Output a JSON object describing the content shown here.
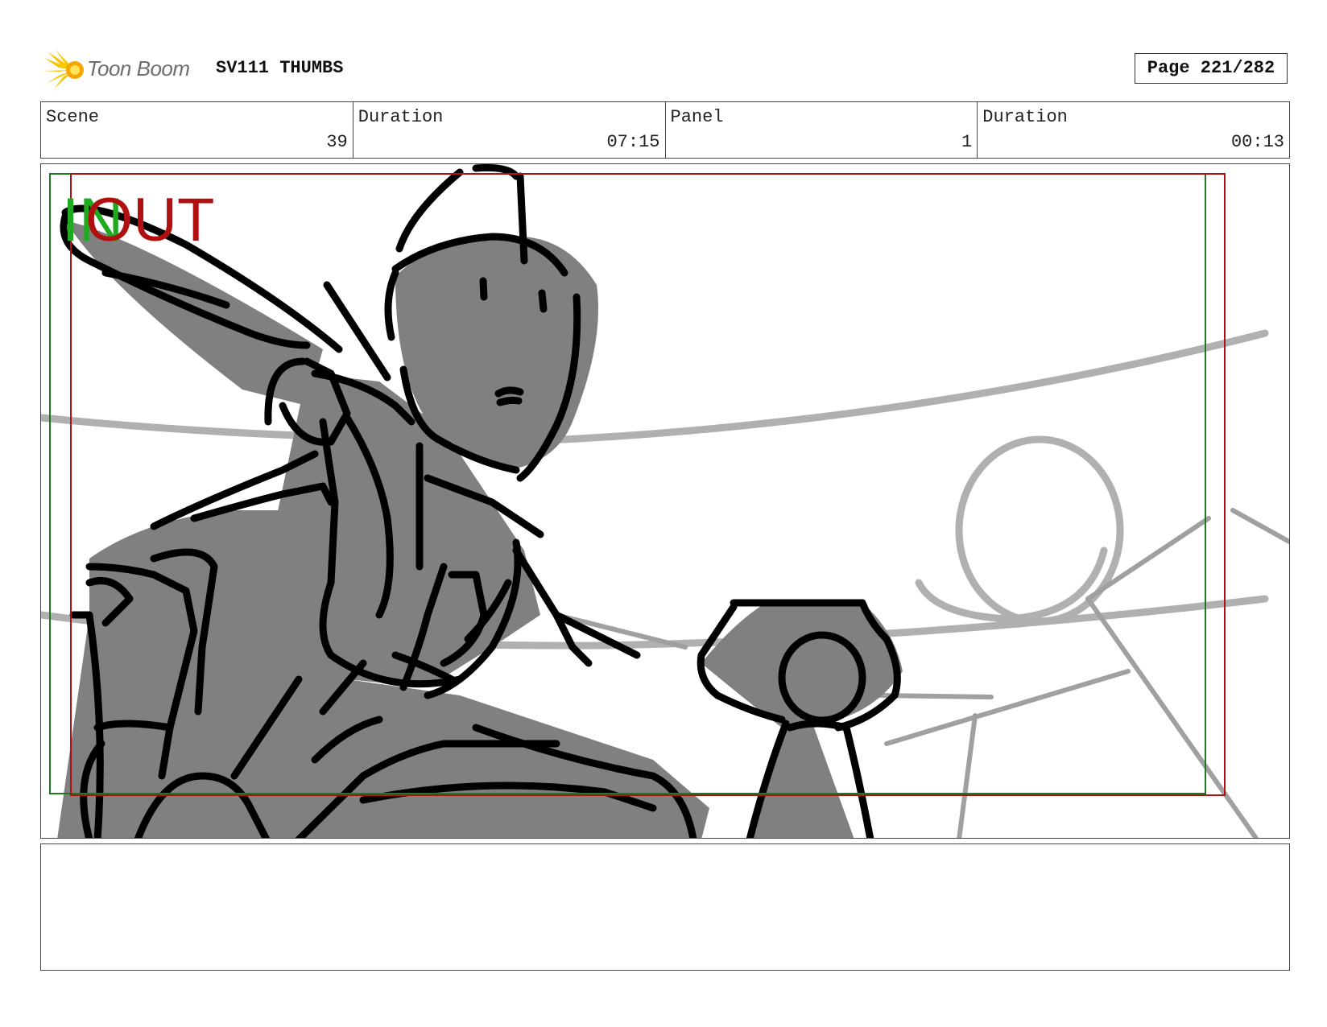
{
  "header": {
    "brand": "Toon Boom",
    "project": "SV111 THUMBS",
    "page": "Page 221/282"
  },
  "infobar": [
    {
      "label": "Scene",
      "value": "39"
    },
    {
      "label": "Duration",
      "value": "07:15"
    },
    {
      "label": "Panel",
      "value": "1"
    },
    {
      "label": "Duration",
      "value": "00:13"
    }
  ],
  "panel": {
    "in_mark": "IN",
    "out_mark": "OUT",
    "colors": {
      "in_frame": "#1e7a1e",
      "out_frame": "#b01010",
      "sketch_fill": "#808080",
      "sketch_line": "#000000",
      "bg_line": "#b0b0b0"
    }
  },
  "notes": {
    "text": ""
  }
}
